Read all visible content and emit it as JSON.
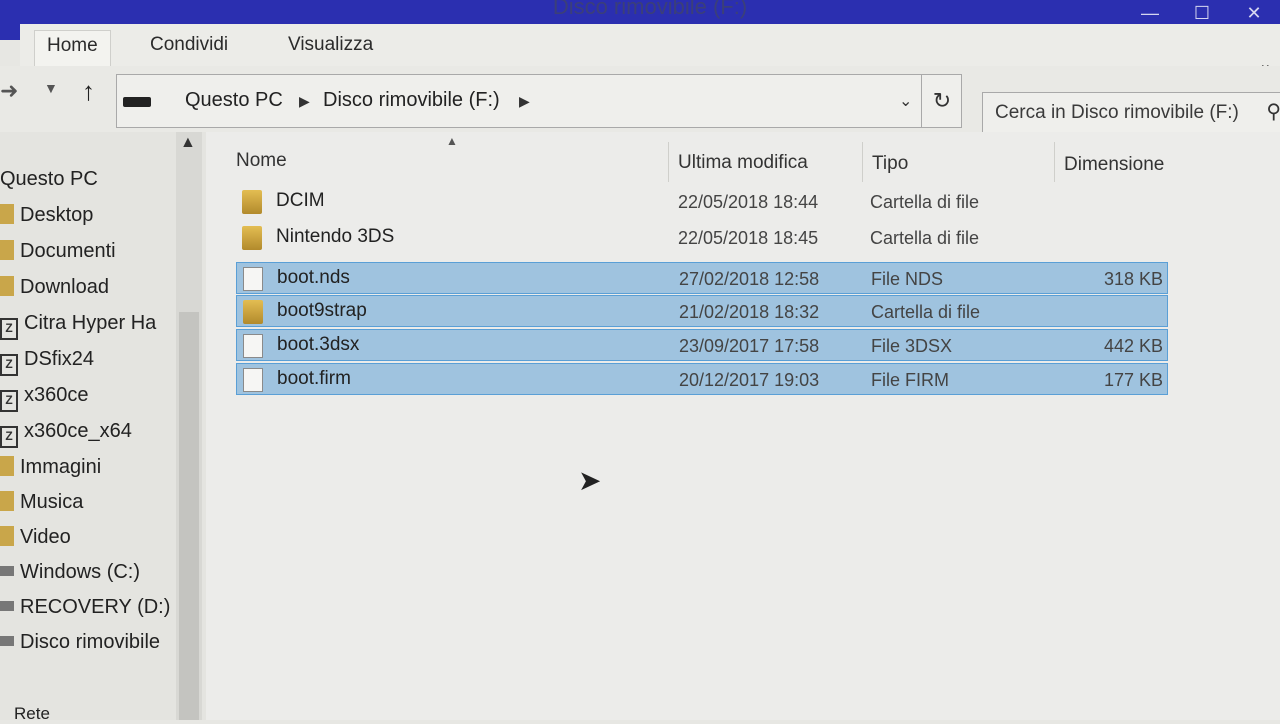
{
  "window": {
    "title": "Disco rimovibile (F:)",
    "controls": {
      "minimize": "—",
      "maximize": "☐",
      "close": "✕"
    }
  },
  "ribbon": {
    "tabs": [
      {
        "label": "Home"
      },
      {
        "label": "Condividi"
      },
      {
        "label": "Visualizza"
      }
    ],
    "expand_icon": "chevron-down-icon"
  },
  "navigation": {
    "back_icon": "back-arrow-icon",
    "recent_icon": "chevron-down-icon",
    "up_icon": "up-arrow-icon",
    "breadcrumb": [
      "Questo PC",
      "Disco rimovibile (F:)"
    ],
    "refresh_icon": "refresh-icon"
  },
  "search": {
    "placeholder": "Cerca in Disco rimovibile (F:)",
    "icon": "search-icon"
  },
  "sidebar": {
    "items": [
      {
        "label": "Questo PC",
        "icon": "pc-icon"
      },
      {
        "label": "Desktop",
        "icon": "folder-icon"
      },
      {
        "label": "Documenti",
        "icon": "folder-icon"
      },
      {
        "label": "Download",
        "icon": "folder-icon"
      },
      {
        "label": "Citra Hyper Ha",
        "icon": "zip-icon"
      },
      {
        "label": "DSfix24",
        "icon": "zip-icon"
      },
      {
        "label": "x360ce",
        "icon": "zip-icon"
      },
      {
        "label": "x360ce_x64",
        "icon": "zip-icon"
      },
      {
        "label": "Immagini",
        "icon": "folder-icon"
      },
      {
        "label": "Musica",
        "icon": "folder-icon"
      },
      {
        "label": "Video",
        "icon": "folder-icon"
      },
      {
        "label": "Windows (C:)",
        "icon": "drive-icon"
      },
      {
        "label": "RECOVERY (D:)",
        "icon": "drive-icon"
      },
      {
        "label": "Disco rimovibile",
        "icon": "drive-icon"
      },
      {
        "label": "Rete",
        "icon": "network-icon"
      }
    ]
  },
  "columns": {
    "name": "Nome",
    "modified": "Ultima modifica",
    "type": "Tipo",
    "size": "Dimensione"
  },
  "files": [
    {
      "name": "DCIM",
      "modified": "22/05/2018 18:44",
      "type": "Cartella di file",
      "size": "",
      "kind": "folder",
      "selected": false
    },
    {
      "name": "Nintendo 3DS",
      "modified": "22/05/2018 18:45",
      "type": "Cartella di file",
      "size": "",
      "kind": "folder",
      "selected": false
    },
    {
      "name": "boot.nds",
      "modified": "27/02/2018 12:58",
      "type": "File NDS",
      "size": "318 KB",
      "kind": "file",
      "selected": true
    },
    {
      "name": "boot9strap",
      "modified": "21/02/2018 18:32",
      "type": "Cartella di file",
      "size": "",
      "kind": "folder",
      "selected": true
    },
    {
      "name": "boot.3dsx",
      "modified": "23/09/2017 17:58",
      "type": "File 3DSX",
      "size": "442 KB",
      "kind": "file",
      "selected": true
    },
    {
      "name": "boot.firm",
      "modified": "20/12/2017 19:03",
      "type": "File FIRM",
      "size": "177 KB",
      "kind": "file",
      "selected": true
    }
  ],
  "colors": {
    "titlebar": "#2b2fb0",
    "selection": "#9fc3df",
    "selection_border": "#5a9fd6"
  }
}
